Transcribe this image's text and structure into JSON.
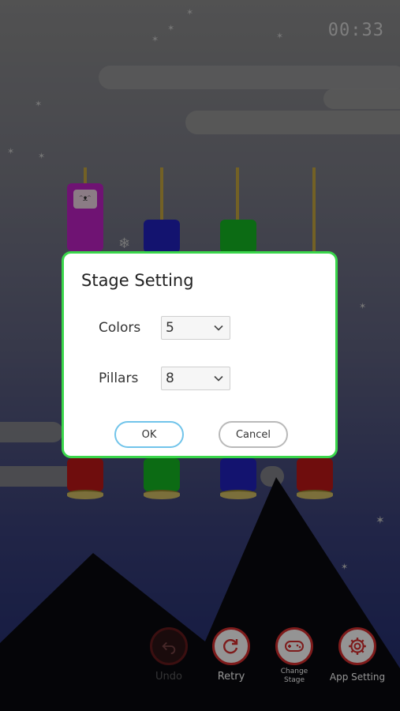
{
  "timer": "00:33",
  "dialog": {
    "title": "Stage Setting",
    "colors_label": "Colors",
    "colors_value": "5",
    "pillars_label": "Pillars",
    "pillars_value": "8",
    "ok_label": "OK",
    "cancel_label": "Cancel"
  },
  "toolbar": {
    "undo": "Undo",
    "retry": "Retry",
    "change_stage_line1": "Change",
    "change_stage_line2": "Stage",
    "app_setting": "App Setting"
  },
  "icons": {
    "undo": "undo-icon",
    "retry": "retry-icon",
    "change_stage": "gamepad-icon",
    "app_setting": "gear-icon",
    "dropdown": "chevron-down-icon"
  },
  "colors": {
    "dialog_border": "#3ad64b",
    "ok_border": "#71c4ea",
    "toolbar_ring": "#d93030"
  }
}
